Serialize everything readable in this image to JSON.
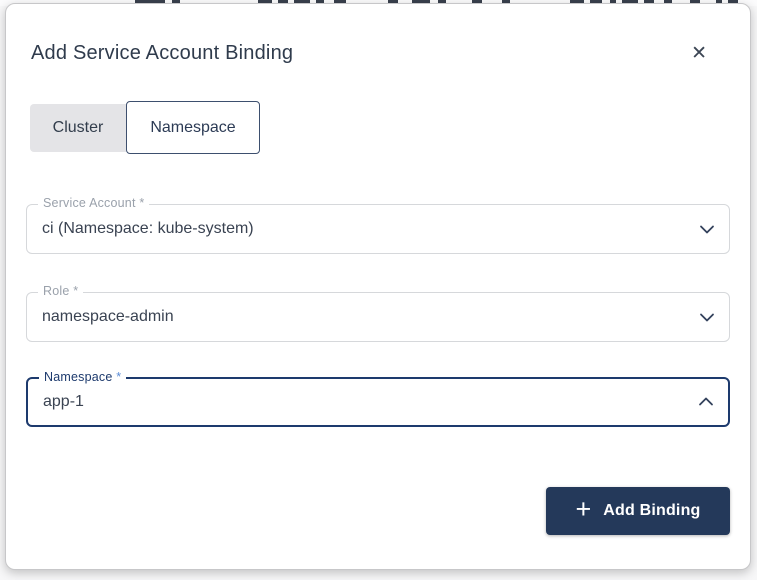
{
  "modal": {
    "title": "Add Service Account Binding",
    "close_icon": "✕"
  },
  "tabs": {
    "cluster": {
      "label": "Cluster",
      "selected": false
    },
    "namespace": {
      "label": "Namespace",
      "selected": true
    }
  },
  "fields": {
    "service_account": {
      "label": "Service Account",
      "required_marker": "*",
      "value": "ci (Namespace: kube-system)",
      "state": "closed"
    },
    "role": {
      "label": "Role",
      "required_marker": "*",
      "value": "namespace-admin",
      "state": "closed"
    },
    "namespace": {
      "label": "Namespace",
      "required_marker": "*",
      "value": "app-1",
      "state": "open"
    }
  },
  "footer": {
    "add_button_label": "Add Binding",
    "plus_icon": "+"
  },
  "colors": {
    "accent_navy": "#24395a",
    "focused_border": "#1d3a6d",
    "field_border": "#d6d8db",
    "label_gray": "#9aa1ab",
    "title_text": "#2f3b4c",
    "tab_unselected_bg": "#e4e4e7"
  }
}
